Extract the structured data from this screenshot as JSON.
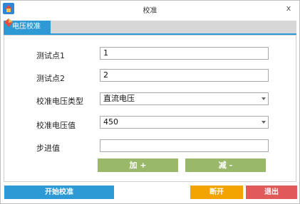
{
  "window": {
    "title": "校准",
    "close_label": "x"
  },
  "tabs": [
    {
      "label": "电压校准",
      "active": true
    }
  ],
  "form": {
    "test_point_1": {
      "label": "测试点1",
      "value": "1"
    },
    "test_point_2": {
      "label": "测试点2",
      "value": "2"
    },
    "voltage_type": {
      "label": "校准电压类型",
      "value": "直流电压"
    },
    "voltage_value": {
      "label": "校准电压值",
      "value": "450"
    },
    "step_value": {
      "label": "步进值",
      "value": ""
    }
  },
  "actions": {
    "add_label": "加 +",
    "subtract_label": "减 -",
    "start_label": "开始校准",
    "disconnect_label": "断开",
    "exit_label": "退出"
  },
  "colors": {
    "accent_blue": "#2d9ad6",
    "green": "#9ab86a",
    "orange": "#f3a300",
    "red": "#e05a5a"
  }
}
